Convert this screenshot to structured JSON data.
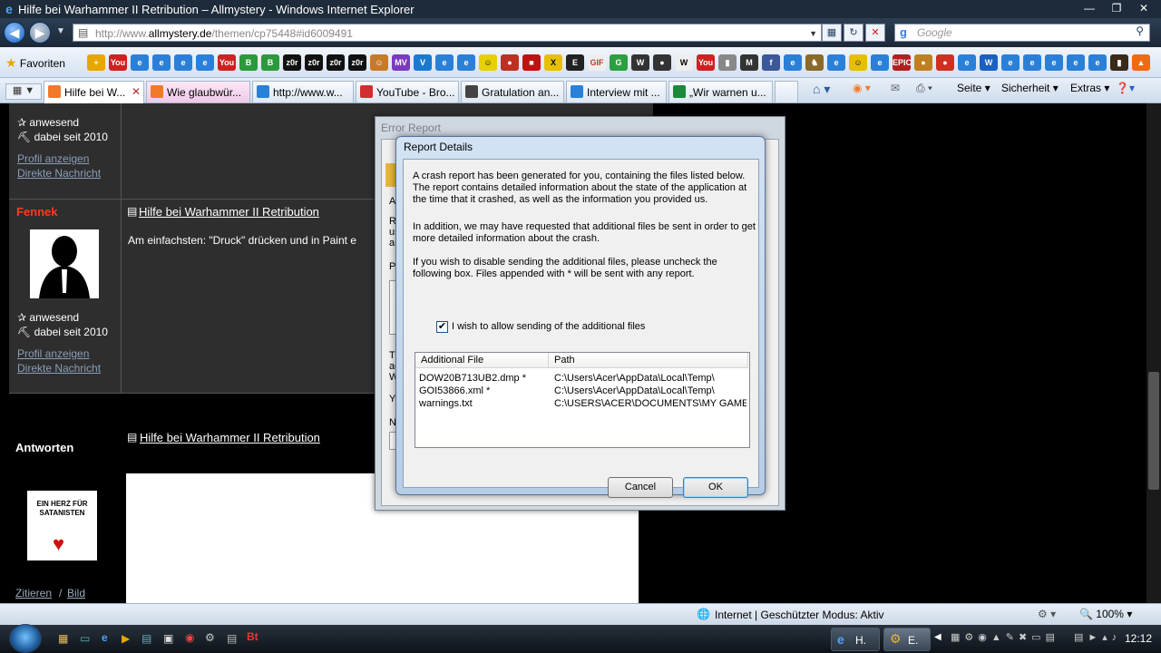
{
  "window": {
    "title": "Hilfe bei Warhammer II Retribution – Allmystery - Windows Internet Explorer"
  },
  "address": {
    "url_prefix": "http://www.",
    "url_domain": "allmystery.de",
    "url_path": "/themen/cp75448#id6009491"
  },
  "search": {
    "placeholder": "Google"
  },
  "favorites": {
    "label": "Favoriten"
  },
  "tabs": [
    {
      "label": "Hilfe bei W...",
      "color": "#f07a2a"
    },
    {
      "label": "Wie glaubwür...",
      "color": "#f07a2a"
    },
    {
      "label": "http://www.w...",
      "color": "#2a80d8"
    },
    {
      "label": "YouTube - Bro...",
      "color": "#d03030"
    },
    {
      "label": "Gratulation an...",
      "color": "#444444"
    },
    {
      "label": "Interview mit ...",
      "color": "#2a80d8"
    },
    {
      "label": "„Wir warnen u...",
      "color": "#1a8a3a"
    }
  ],
  "commands": {
    "seite": "Seite",
    "sicherheit": "Sicherheit",
    "extras": "Extras"
  },
  "page": {
    "user1": {
      "status": "anwesend",
      "since": "dabei seit 2010",
      "profile": "Profil anzeigen",
      "message": "Direkte Nachricht"
    },
    "user2": {
      "name": "Fennek",
      "status": "anwesend",
      "since": "dabei seit 2010",
      "profile": "Profil anzeigen",
      "message": "Direkte Nachricht"
    },
    "post_title": "Hilfe bei Warhammer II Retribution",
    "post_text": "Am einfachsten: \"Druck\" drücken und in Paint e",
    "reply_heading": "Antworten",
    "reply_title": "Hilfe bei Warhammer II Retribution",
    "avatar2_text": "EIN HERZ FÜR SATANISTEN",
    "quote": "Zitieren",
    "slash": "/",
    "image": "Bild"
  },
  "error_dialog": {
    "title": "Error Report",
    "letters": [
      "A",
      "Re",
      "us",
      "an",
      "Pl",
      "Th",
      "ac",
      "W",
      "Yo",
      "N"
    ]
  },
  "report_dialog": {
    "title": "Report Details",
    "para1": "A crash report has been generated for you, containing the files listed below. The report contains detailed information about the state of the application at the time that it crashed, as well as the information you provided us.",
    "para2": "In addition, we may have requested that additional files be sent in order to get more detailed information about the crash.",
    "para3": "If you wish to disable sending the additional files, please uncheck the following box.  Files appended with * will be sent with any report.",
    "checkbox_label": "I wish to allow sending of the additional files",
    "checkbox_checked": true,
    "col_file": "Additional File",
    "col_path": "Path",
    "files": [
      {
        "name": "DOW20B713UB2.dmp *",
        "path": "C:\\Users\\Acer\\AppData\\Local\\Temp\\"
      },
      {
        "name": "GOI53866.xml *",
        "path": "C:\\Users\\Acer\\AppData\\Local\\Temp\\"
      },
      {
        "name": "warnings.txt",
        "path": "C:\\USERS\\ACER\\DOCUMENTS\\MY GAME..."
      }
    ],
    "cancel": "Cancel",
    "ok": "OK"
  },
  "status": {
    "zone": "Internet | Geschützter Modus: Aktiv",
    "zoom": "100%"
  },
  "taskbar": {
    "btn1": "H.",
    "btn2": "E.",
    "time": "12:12"
  }
}
